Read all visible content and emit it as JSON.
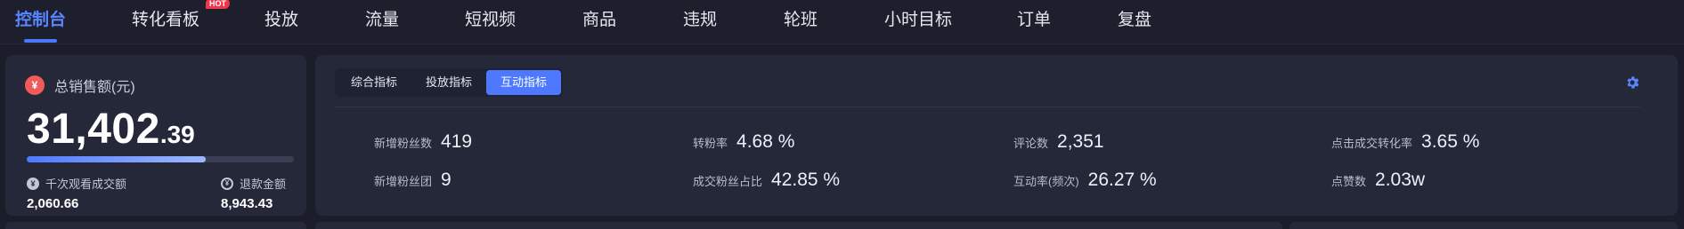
{
  "nav": {
    "items": [
      {
        "label": "控制台",
        "active": true
      },
      {
        "label": "转化看板",
        "badge": "HOT"
      },
      {
        "label": "投放"
      },
      {
        "label": "流量"
      },
      {
        "label": "短视频"
      },
      {
        "label": "商品"
      },
      {
        "label": "违规"
      },
      {
        "label": "轮班"
      },
      {
        "label": "小时目标"
      },
      {
        "label": "订单"
      },
      {
        "label": "复盘"
      }
    ]
  },
  "sales": {
    "title": "总销售额(元)",
    "amount_int": "31,402",
    "amount_dec": ".39",
    "progress": 0.67,
    "stat_left": {
      "label": "千次观看成交额",
      "value": "2,060.66"
    },
    "stat_right": {
      "label": "退款金额",
      "value": "8,943.43"
    }
  },
  "metrics": {
    "tabs": [
      {
        "label": "综合指标"
      },
      {
        "label": "投放指标"
      },
      {
        "label": "互动指标",
        "active": true
      }
    ],
    "rows": [
      [
        {
          "label": "新增粉丝数",
          "value": "419"
        },
        {
          "label": "转粉率",
          "value": "4.68 %"
        },
        {
          "label": "评论数",
          "value": "2,351"
        },
        {
          "label": "点击成交转化率",
          "value": "3.65 %"
        }
      ],
      [
        {
          "label": "新增粉丝团",
          "value": "9"
        },
        {
          "label": "成交粉丝占比",
          "value": "42.85 %"
        },
        {
          "label": "互动率(频次)",
          "value": "26.27 %"
        },
        {
          "label": "点赞数",
          "value": "2.03w"
        }
      ]
    ]
  },
  "colors": {
    "accent": "#4e79ff",
    "hot_badge": "#f0364a",
    "sales_icon": "#f05a5a",
    "background": "#1b1d2b",
    "card": "#252839"
  }
}
